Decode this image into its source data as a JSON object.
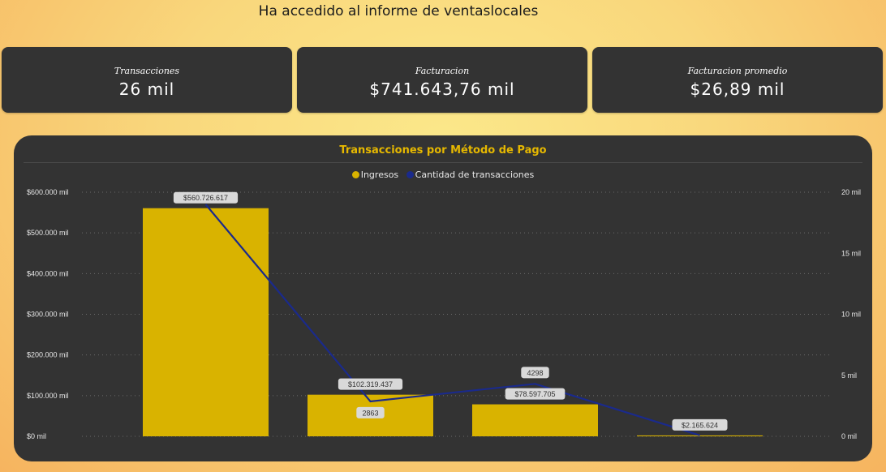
{
  "header": {
    "title": "Ha accedido al informe de ventaslocales"
  },
  "kpis": [
    {
      "label": "Transacciones",
      "value": "26 mil"
    },
    {
      "label": "Facturacion",
      "value": "$741.643,76 mil"
    },
    {
      "label": "Facturacion promedio",
      "value": "$26,89 mil"
    }
  ],
  "colors": {
    "bar": "#d9b300",
    "line": "#1a2a8c",
    "title": "#e6b800"
  },
  "chart_data": {
    "type": "bar",
    "title": "Transacciones por Método de Pago",
    "legend": [
      "Ingresos",
      "Cantidad de transacciones"
    ],
    "legend_position": "top-center",
    "grid": true,
    "categories": [
      "",
      "",
      "",
      ""
    ],
    "series": [
      {
        "name": "Ingresos",
        "type": "bar",
        "axis": "left",
        "values": [
          560726617,
          102319437,
          78597705,
          2165624
        ],
        "labels": [
          "$560.726.617",
          "$102.319.437",
          "$78.597.705",
          "$2.165.624"
        ]
      },
      {
        "name": "Cantidad de transacciones",
        "type": "line",
        "axis": "right",
        "values": [
          19000,
          2863,
          4298,
          80
        ],
        "labels": [
          "",
          "2863",
          "4298",
          ""
        ]
      }
    ],
    "ylim_left": [
      0,
      600000000
    ],
    "yticks_left": [
      "$0 mil",
      "$100.000 mil",
      "$200.000 mil",
      "$300.000 mil",
      "$400.000 mil",
      "$500.000 mil",
      "$600.000 mil"
    ],
    "ylim_right": [
      0,
      20000
    ],
    "yticks_right": [
      "0 mil",
      "5 mil",
      "10 mil",
      "15 mil",
      "20 mil"
    ]
  }
}
